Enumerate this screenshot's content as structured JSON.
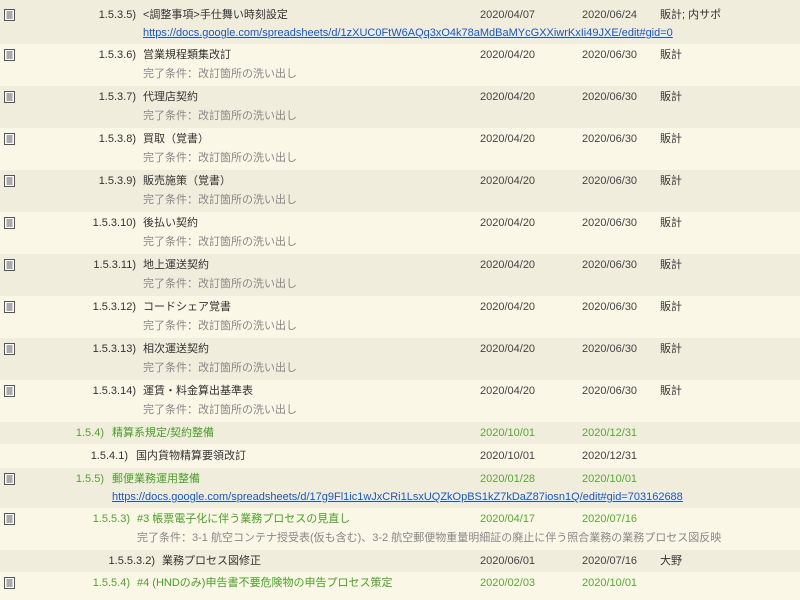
{
  "rows": [
    {
      "num": "1.5.3.5)",
      "title": "<調整事項>手仕舞い時刻設定",
      "start": "2020/04/07",
      "end": "2020/06/24",
      "owner": "販計; 内サポ",
      "link": "https://docs.google.com/spreadsheets/d/1zXUC0FtW6AQq3xO4k78aMdBaMYcGXXiwrKxIi49JXE/edit#gid=0"
    },
    {
      "num": "1.5.3.6)",
      "title": "営業規程類集改訂",
      "start": "2020/04/20",
      "end": "2020/06/30",
      "owner": "販計",
      "sub": "完了条件：改訂箇所の洗い出し"
    },
    {
      "num": "1.5.3.7)",
      "title": "代理店契約",
      "start": "2020/04/20",
      "end": "2020/06/30",
      "owner": "販計",
      "sub": "完了条件：改訂箇所の洗い出し"
    },
    {
      "num": "1.5.3.8)",
      "title": "買取（覚書）",
      "start": "2020/04/20",
      "end": "2020/06/30",
      "owner": "販計",
      "sub": "完了条件：改訂箇所の洗い出し"
    },
    {
      "num": "1.5.3.9)",
      "title": "販売施策（覚書）",
      "start": "2020/04/20",
      "end": "2020/06/30",
      "owner": "販計",
      "sub": "完了条件：改訂箇所の洗い出し"
    },
    {
      "num": "1.5.3.10)",
      "title": "後払い契約",
      "start": "2020/04/20",
      "end": "2020/06/30",
      "owner": "販計",
      "sub": "完了条件：改訂箇所の洗い出し"
    },
    {
      "num": "1.5.3.11)",
      "title": "地上運送契約",
      "start": "2020/04/20",
      "end": "2020/06/30",
      "owner": "販計",
      "sub": "完了条件：改訂箇所の洗い出し"
    },
    {
      "num": "1.5.3.12)",
      "title": "コードシェア覚書",
      "start": "2020/04/20",
      "end": "2020/06/30",
      "owner": "販計",
      "sub": "完了条件：改訂箇所の洗い出し"
    },
    {
      "num": "1.5.3.13)",
      "title": "相次運送契約",
      "start": "2020/04/20",
      "end": "2020/06/30",
      "owner": "販計",
      "sub": "完了条件：改訂箇所の洗い出し"
    },
    {
      "num": "1.5.3.14)",
      "title": "運賃・料金算出基準表",
      "start": "2020/04/20",
      "end": "2020/06/30",
      "owner": "販計",
      "sub": "完了条件：改訂箇所の洗い出し"
    },
    {
      "num": "1.5.4)",
      "title": "精算系規定/契約整備",
      "start": "2020/10/01",
      "end": "2020/12/31",
      "owner": ""
    },
    {
      "num": "1.5.4.1)",
      "title": "国内貨物精算要領改訂",
      "start": "2020/10/01",
      "end": "2020/12/31",
      "owner": ""
    },
    {
      "num": "1.5.5)",
      "title": "郵便業務運用整備",
      "start": "2020/01/28",
      "end": "2020/10/01",
      "owner": "",
      "link": "https://docs.google.com/spreadsheets/d/17g9Fl1ic1wJxCRi1LsxUQZkOpBS1kZ7kDaZ87iosn1Q/edit#gid=703162688"
    },
    {
      "num": "1.5.5.3)",
      "title": "#3 帳票電子化に伴う業務プロセスの見直し",
      "start": "2020/04/17",
      "end": "2020/07/16",
      "owner": "",
      "sub": "完了条件：3-1 航空コンテナ授受表(仮も含む)、3-2 航空郵便物重量明細証の廃止に伴う照合業務の業務プロセス図反映"
    },
    {
      "num": "1.5.5.3.2)",
      "title": "業務プロセス図修正",
      "start": "2020/06/01",
      "end": "2020/07/16",
      "owner": "大野"
    },
    {
      "num": "1.5.5.4)",
      "title": "#4 (HNDのみ)申告書不要危険物の申告プロセス策定",
      "start": "2020/02/03",
      "end": "2020/10/01",
      "owner": ""
    }
  ]
}
